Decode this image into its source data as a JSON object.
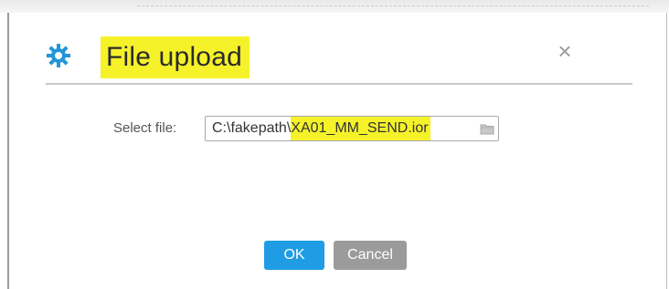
{
  "dialog": {
    "title": "File upload",
    "title_icon": "gear-icon",
    "close_symbol": "×"
  },
  "form": {
    "label": "Select file:",
    "path_prefix": "C:\\fakepath\\",
    "path_file": "XA01_MM_SEND.ior",
    "browse_icon": "folder-icon"
  },
  "buttons": {
    "ok": "OK",
    "cancel": "Cancel"
  },
  "colors": {
    "highlight": "#f5f22a",
    "gear": "#2196d8",
    "ok": "#1f9ce3",
    "cancel": "#9b9b9b"
  }
}
